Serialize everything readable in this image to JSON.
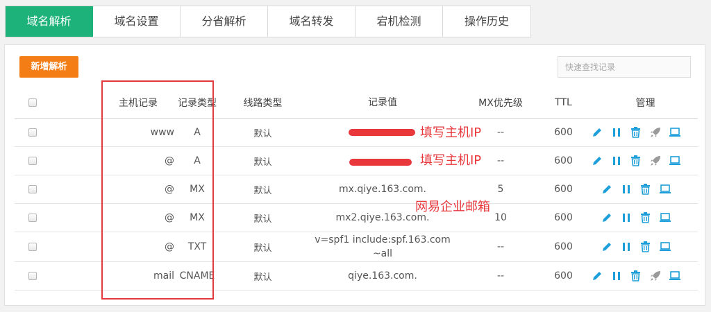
{
  "tabs": [
    {
      "label": "域名解析",
      "active": true
    },
    {
      "label": "域名设置"
    },
    {
      "label": "分省解析"
    },
    {
      "label": "域名转发"
    },
    {
      "label": "宕机检测"
    },
    {
      "label": "操作历史"
    }
  ],
  "toolbar": {
    "add_label": "新增解析",
    "search_placeholder": "快速查找记录"
  },
  "columns": {
    "host": "主机记录",
    "type": "记录类型",
    "line": "线路类型",
    "value": "记录值",
    "mx": "MX优先级",
    "ttl": "TTL",
    "manage": "管理"
  },
  "rows": [
    {
      "host": "www",
      "type": "A",
      "line": "默认",
      "value": "",
      "mx": "--",
      "ttl": "600"
    },
    {
      "host": "@",
      "type": "A",
      "line": "默认",
      "value": "",
      "mx": "--",
      "ttl": "600"
    },
    {
      "host": "@",
      "type": "MX",
      "line": "默认",
      "value": "mx.qiye.163.com.",
      "mx": "5",
      "ttl": "600"
    },
    {
      "host": "@",
      "type": "MX",
      "line": "默认",
      "value": "mx2.qiye.163.com.",
      "mx": "10",
      "ttl": "600"
    },
    {
      "host": "@",
      "type": "TXT",
      "line": "默认",
      "value": "v=spf1 include:spf.163.com ~all",
      "mx": "--",
      "ttl": "600"
    },
    {
      "host": "mail",
      "type": "CNAME",
      "line": "默认",
      "value": "qiye.163.com.",
      "mx": "--",
      "ttl": "600"
    }
  ],
  "annotations": {
    "fill_ip_1": "填写主机IP",
    "fill_ip_2": "填写主机IP",
    "netease": "网易企业邮箱"
  },
  "colors": {
    "accent": "#1cb27a",
    "add_button": "#f57d16",
    "icon": "#1e9fd9",
    "icon_disabled": "#9a9a9a",
    "annotation": "#e8383c"
  }
}
